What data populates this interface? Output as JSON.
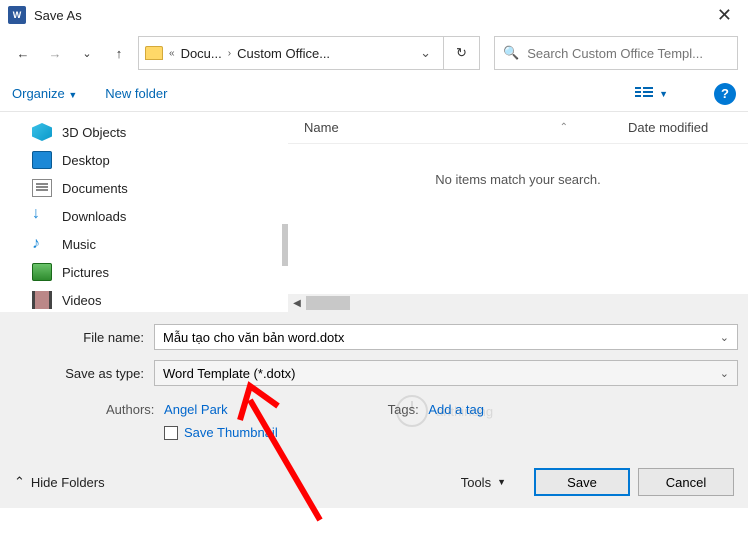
{
  "titlebar": {
    "title": "Save As"
  },
  "nav": {
    "path_seg1": "Docu...",
    "path_seg2": "Custom Office..."
  },
  "search": {
    "placeholder": "Search Custom Office Templ..."
  },
  "toolbar": {
    "organize": "Organize",
    "newfolder": "New folder"
  },
  "navpane": {
    "items": [
      {
        "label": "3D Objects"
      },
      {
        "label": "Desktop"
      },
      {
        "label": "Documents"
      },
      {
        "label": "Downloads"
      },
      {
        "label": "Music"
      },
      {
        "label": "Pictures"
      },
      {
        "label": "Videos"
      }
    ]
  },
  "cols": {
    "name": "Name",
    "date": "Date modified"
  },
  "empty_msg": "No items match your search.",
  "fields": {
    "filename_label": "File name:",
    "filename_value": "Mẫu tạo cho văn bản word.dotx",
    "type_label": "Save as type:",
    "type_value": "Word Template (*.dotx)",
    "authors_label": "Authors:",
    "authors_value": "Angel Park",
    "tags_label": "Tags:",
    "tags_value": "Add a tag",
    "save_thumb": "Save Thumbnail"
  },
  "footer": {
    "hide": "Hide Folders",
    "tools": "Tools",
    "save": "Save",
    "cancel": "Cancel"
  },
  "watermark": "anthinong"
}
